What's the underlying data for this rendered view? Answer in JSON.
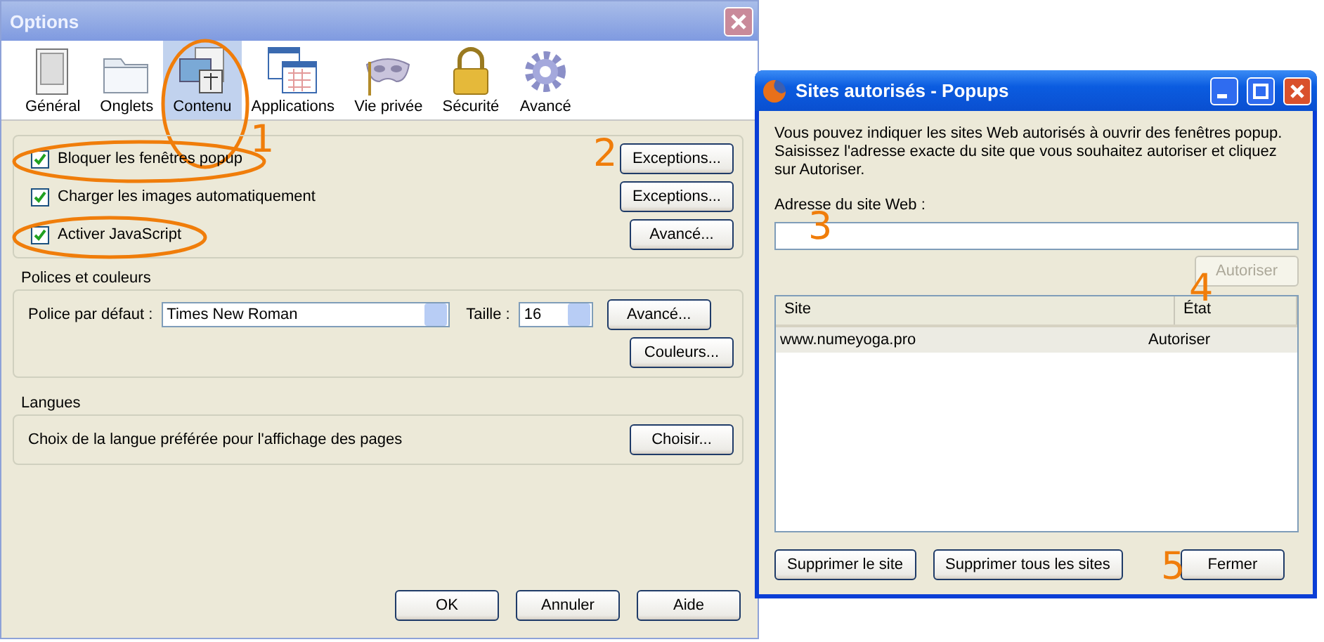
{
  "options_window": {
    "title": "Options",
    "tabs": [
      {
        "label": "Général",
        "selected": false,
        "circled": false
      },
      {
        "label": "Onglets",
        "selected": false,
        "circled": false
      },
      {
        "label": "Contenu",
        "selected": true,
        "circled": true
      },
      {
        "label": "Applications",
        "selected": false,
        "circled": false
      },
      {
        "label": "Vie privée",
        "selected": false,
        "circled": false
      },
      {
        "label": "Sécurité",
        "selected": false,
        "circled": false
      },
      {
        "label": "Avancé",
        "selected": false,
        "circled": false
      }
    ],
    "checkboxes": [
      {
        "label": "Bloquer les fenêtres popup",
        "checked": true,
        "circled": true,
        "button": "Exceptions..."
      },
      {
        "label": "Charger les images automatiquement",
        "checked": true,
        "circled": false,
        "button": "Exceptions..."
      },
      {
        "label": "Activer JavaScript",
        "checked": true,
        "circled": true,
        "button": "Avancé..."
      }
    ],
    "fonts_group": {
      "title": "Polices et couleurs",
      "font_label": "Police par défaut :",
      "font_value": "Times New Roman",
      "size_label": "Taille :",
      "size_value": "16",
      "buttons": [
        "Avancé...",
        "Couleurs..."
      ]
    },
    "languages_group": {
      "title": "Langues",
      "text": "Choix de la langue préférée pour l'affichage des pages",
      "button": "Choisir..."
    },
    "buttons": [
      "OK",
      "Annuler",
      "Aide"
    ]
  },
  "popup_window": {
    "title": "Sites autorisés - Popups",
    "description": "Vous pouvez indiquer les sites Web autorisés à ouvrir des fenêtres popup. Saisissez l'adresse exacte du site que vous souhaitez autoriser et cliquez sur Autoriser.",
    "address_label": "Adresse du site Web :",
    "allow_button": {
      "label": "Autoriser",
      "disabled": true
    },
    "table": {
      "columns": [
        "Site",
        "État"
      ],
      "rows": [
        {
          "cells": [
            "www.numeyoga.pro",
            "Autoriser"
          ],
          "selected": true
        }
      ]
    },
    "buttons": [
      "Supprimer le site",
      "Supprimer tous les sites",
      "Fermer"
    ]
  },
  "annotations": [
    {
      "label": "1"
    },
    {
      "label": "2"
    },
    {
      "label": "3"
    },
    {
      "label": "4"
    },
    {
      "label": "5"
    }
  ]
}
